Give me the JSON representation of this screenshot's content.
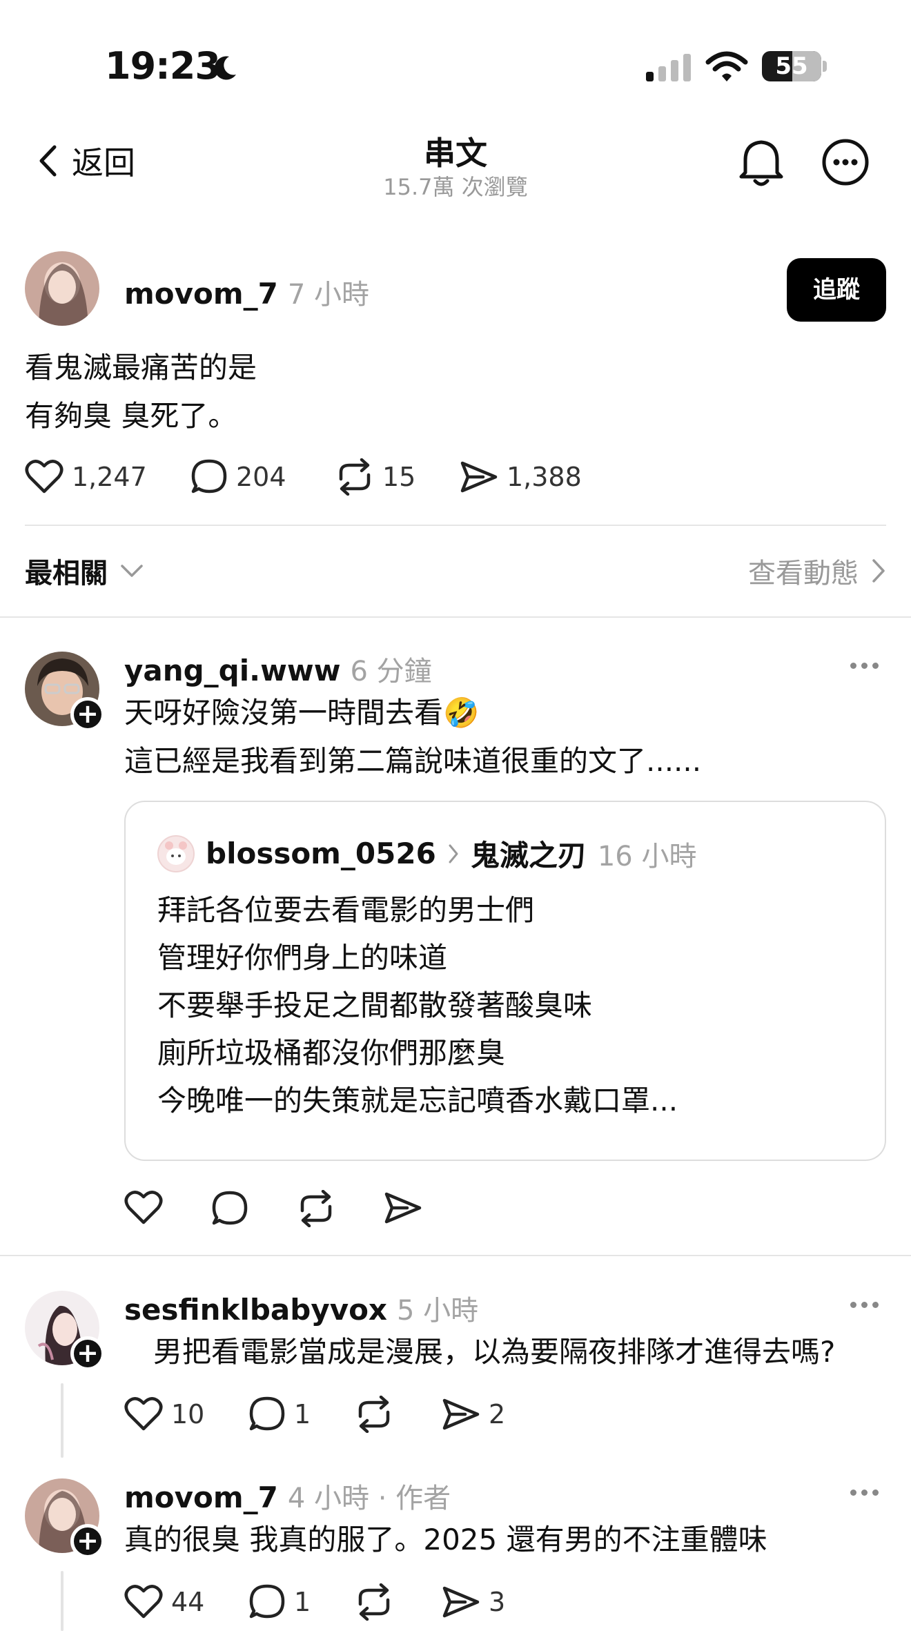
{
  "status_bar": {
    "time": "19:23",
    "battery": "55"
  },
  "nav": {
    "back_label": "返回",
    "title": "串文",
    "views": "15.7萬 次瀏覽"
  },
  "post": {
    "username": "movom_7",
    "time": "7 小時",
    "follow_label": "追蹤",
    "lines": [
      "看鬼滅最痛苦的是",
      "有夠臭 臭死了。"
    ],
    "likes": "1,247",
    "comments": "204",
    "reposts": "15",
    "shares": "1,388"
  },
  "sort": {
    "label": "最相關",
    "activity_label": "查看動態"
  },
  "replies": [
    {
      "username": "yang_qi.www",
      "time": "6 分鐘",
      "lines": [
        "天呀好險沒第一時間去看🤣",
        "這已經是我看到第二篇說味道很重的文了......"
      ],
      "quote": {
        "username": "blossom_0526",
        "topic": "鬼滅之刃",
        "time": "16 小時",
        "lines": [
          "拜託各位要去看電影的男士們",
          "管理好你們身上的味道",
          "不要舉手投足之間都散發著酸臭味",
          "廁所垃圾桶都沒你們那麼臭",
          "今晚唯一的失策就是忘記噴香水戴口罩..."
        ]
      }
    },
    {
      "username": "sesfinklbabyvox",
      "time": "5 小時",
      "text": "　男把看電影當成是漫展，以為要隔夜排隊才進得去嗎?",
      "likes": "10",
      "comments": "1",
      "shares": "2"
    },
    {
      "username": "movom_7",
      "time": "4 小時 · 作者",
      "text": "真的很臭 我真的服了。2025 還有男的不注重體味",
      "likes": "44",
      "comments": "1",
      "shares": "3"
    }
  ],
  "colors": {
    "accent": "#000000",
    "muted": "#a3a3a3",
    "divider": "#e5e5e5"
  }
}
